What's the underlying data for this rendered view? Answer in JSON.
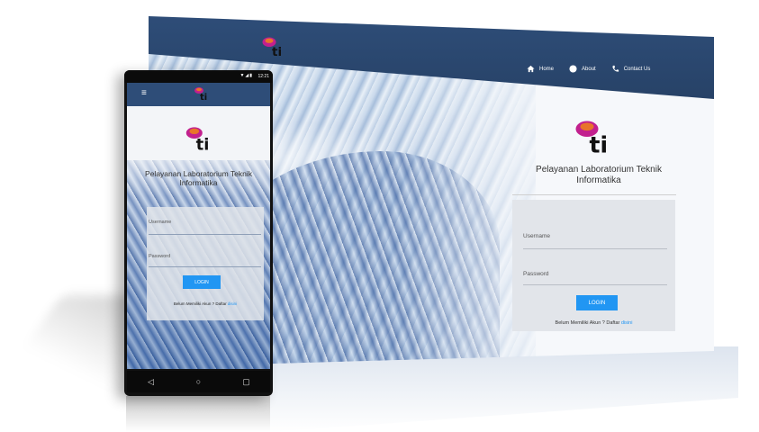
{
  "brand": {
    "logo_text": "ti"
  },
  "desktop": {
    "nav": [
      {
        "label": "Home",
        "icon": "home-icon"
      },
      {
        "label": "About",
        "icon": "info-circle-icon"
      },
      {
        "label": "Contact Us",
        "icon": "phone-icon"
      }
    ],
    "title": "Pelayanan Laboratorium Teknik Informatika",
    "form": {
      "username_label": "Username",
      "password_label": "Password",
      "login_button": "LOGIN",
      "register_text": "Belum Memiliki Akun ? Daftar",
      "register_link": "disini"
    }
  },
  "phone": {
    "status_time": "12:21",
    "title": "Pelayanan Laboratorium Teknik Informatika",
    "form": {
      "username_label": "Username",
      "password_label": "Password",
      "login_button": "LOGIN",
      "register_text": "Belum Memiliki Akun ? Daftar",
      "register_link": "disini"
    },
    "navbar": {
      "back": "◁",
      "home": "○",
      "recent": "▢"
    }
  },
  "colors": {
    "navbar": "#2e4d78",
    "button": "#2196f3",
    "link": "#2196f3",
    "logo_pink": "#c2208e",
    "logo_orange": "#e8742a"
  }
}
